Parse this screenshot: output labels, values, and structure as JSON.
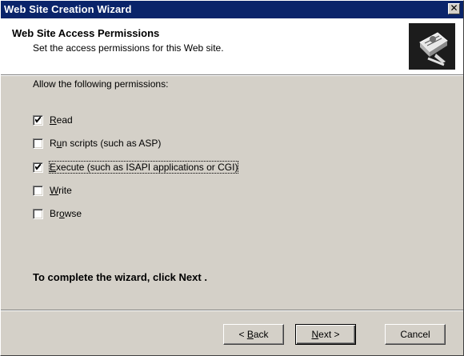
{
  "window": {
    "title": "Web Site Creation Wizard",
    "close_glyph": "✕"
  },
  "header": {
    "title": "Web Site Access Permissions",
    "subtitle": "Set the access permissions for this Web site.",
    "icon": "wizard-book-icon"
  },
  "permissions": {
    "label": "Allow the following permissions:",
    "items": [
      {
        "label": "Read",
        "checked": true,
        "mnemonic_index": 0
      },
      {
        "label": "Run scripts (such as ASP)",
        "checked": false,
        "mnemonic_index": 1
      },
      {
        "label": "Execute (such as ISAPI applications or CGI)",
        "checked": true,
        "mnemonic_index": 0,
        "focused": true
      },
      {
        "label": "Write",
        "checked": false,
        "mnemonic_index": 0
      },
      {
        "label": "Browse",
        "checked": false,
        "mnemonic_index": 2
      }
    ]
  },
  "footer": {
    "instruction": "To complete the wizard, click Next ."
  },
  "buttons": {
    "back": "< Back",
    "next": "Next >",
    "cancel": "Cancel"
  },
  "colors": {
    "titlebar": "#0a246a",
    "dialog_bg": "#d4d0c8",
    "header_bg": "#ffffff"
  }
}
